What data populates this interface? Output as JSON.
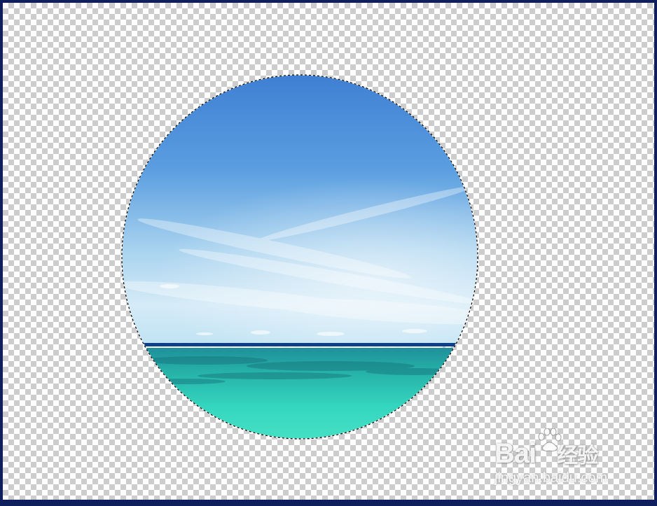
{
  "canvas": {
    "checker_light": "#ffffff",
    "checker_dark": "#cccccc",
    "frame_color": "#0f1f5e"
  },
  "selection": {
    "shape": "ellipse",
    "style": "marching-ants"
  },
  "image": {
    "sky_top": "#3f86d6",
    "sky_bottom": "#d6ecf6",
    "horizon": "#0f3f8a",
    "sea_dark": "#1f9f96",
    "sea_light": "#3fe0c0"
  },
  "watermark": {
    "logo_text": "Bai",
    "logo_suffix": "经验",
    "sub_text": "jingyan.baidu.com",
    "paw_icon": "baidu-paw-icon"
  }
}
